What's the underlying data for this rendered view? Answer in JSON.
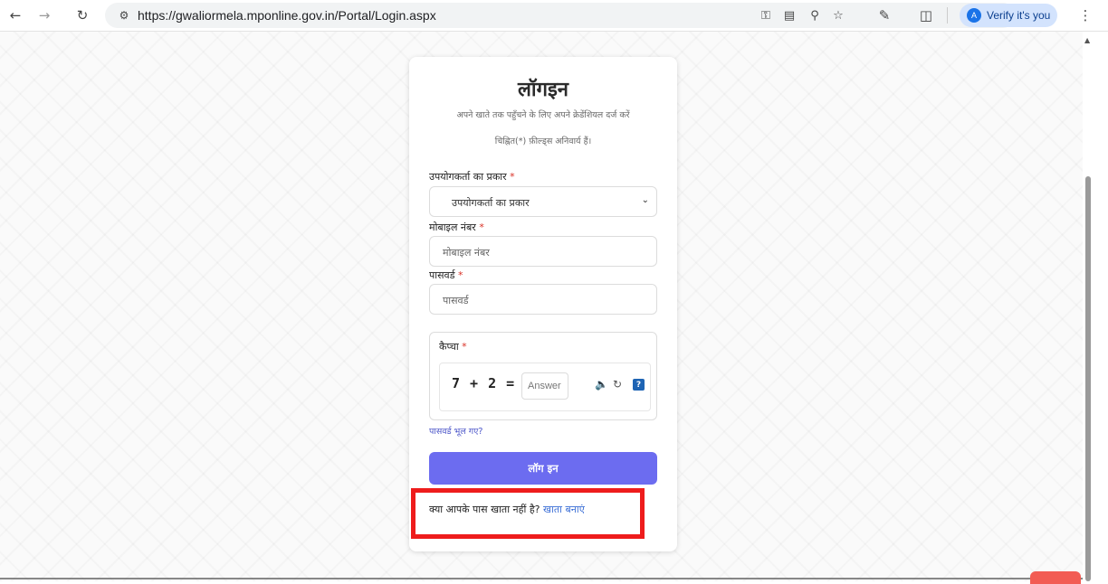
{
  "browser": {
    "url": "https://gwaliormela.mponline.gov.in/Portal/Login.aspx",
    "verify_label": "Verify it's you",
    "verify_avatar": "A"
  },
  "login": {
    "title": "लॉगइन",
    "subtitle": "अपने खाते तक पहुँचने के लिए अपने क्रेडेंशियल दर्ज करें",
    "mandatory_note": "चिह्नित(*) फ़ील्ड्स अनिवार्य हैं।",
    "user_type_label": "उपयोगकर्ता का प्रकार",
    "user_type_selected": "उपयोगकर्ता का प्रकार",
    "mobile_label": "मोबाइल नंबर",
    "mobile_placeholder": "मोबाइल नंबर",
    "password_label": "पासवर्ड",
    "password_placeholder": "पासवर्ड",
    "captcha_label": "कैप्चा",
    "captcha_equation": "7 + 2 =",
    "captcha_answer_placeholder": "Answer",
    "required_mark": "*",
    "forgot_password": "पासवर्ड भूल गए?",
    "login_button": "लॉग इन",
    "no_account_text": "क्या आपके पास खाता नहीं है?",
    "create_account_link": "खाता बनाएं"
  },
  "colors": {
    "accent_button": "#6c6cf0",
    "link": "#3c6fd6",
    "highlight_box": "#ee1c1c"
  }
}
